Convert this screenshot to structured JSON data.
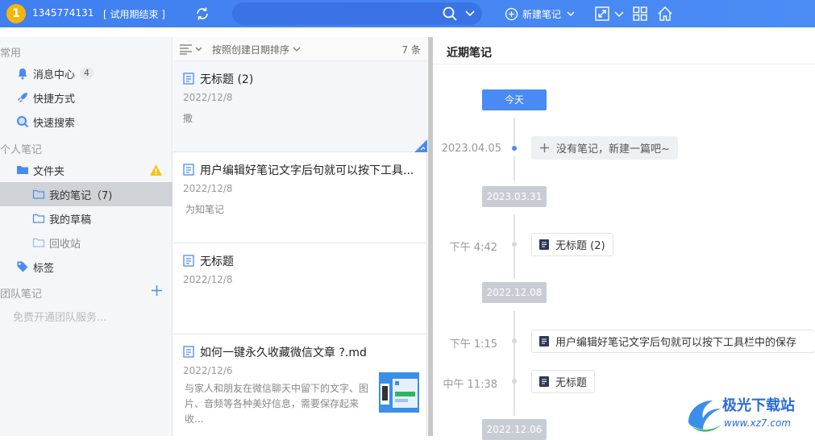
{
  "topbar": {
    "avatar_text": "1",
    "user_id": "1345774131",
    "trial_status": "[ 试用期结束 ]",
    "search_placeholder": "",
    "new_note_label": "新建笔记"
  },
  "sidebar": {
    "section_common": "常用",
    "messages_label": "消息中心",
    "messages_count": "4",
    "shortcuts_label": "快捷方式",
    "quick_search_label": "快速搜索",
    "section_personal": "个人笔记",
    "folders_label": "文件夹",
    "my_notes_label": "我的笔记（7)",
    "drafts_label": "我的草稿",
    "recycle_label": "回收站",
    "tags_label": "标签",
    "section_team": "团队笔记",
    "team_promo": "免费开通团队服务..."
  },
  "note_list": {
    "sort_label": "按照创建日期排序",
    "count_label": "7 条",
    "notes": [
      {
        "title": "无标题 (2)",
        "date": "2022/12/8",
        "snippet": "撒"
      },
      {
        "title": "用户编辑好笔记文字后句就可以按下工具...",
        "date": "2022/12/8",
        "snippet": "为知笔记"
      },
      {
        "title": "无标题",
        "date": "2022/12/8",
        "snippet": ""
      },
      {
        "title": "如何一键永久收藏微信文章 ?.md",
        "date": "2022/12/6",
        "snippet_line1": "与家人和朋友在微信聊天中留下的文字、图",
        "snippet_line2": "片、音频等各种美好信息，需要保存起来收..."
      }
    ]
  },
  "recent": {
    "title": "近期笔记",
    "today_label": "今天",
    "empty_date": "2023.04.05",
    "empty_text": "没有笔记，新建一篇吧~",
    "group1_date": "2023.03.31",
    "group1_time": "下午 4:42",
    "group1_note": "无标题 (2)",
    "group2_date": "2022.12.08",
    "group2_time1": "下午 1:15",
    "group2_note1": "用户编辑好笔记文字后句就可以按下工具栏中的保存",
    "group2_time2": "中午 11:38",
    "group2_note2": "无标题",
    "group3_date": "2022.12.06"
  },
  "watermark": {
    "brand": "极光下载站",
    "url": "www.xz7.com"
  },
  "colors": {
    "topbar": "#4286f2",
    "accent": "#4a8af4",
    "avatar": "#f5b60c",
    "warning": "#f5c518"
  }
}
